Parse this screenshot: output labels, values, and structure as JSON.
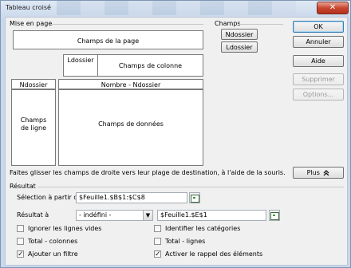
{
  "window": {
    "title": "Tableau croisé",
    "close_glyph": "✕"
  },
  "layout_group": {
    "label": "Mise en page",
    "page_fields": "Champs de la page",
    "column_field_tag": "Ldossier",
    "column_fields": "Champs de colonne",
    "row_field_tag": "Ndossier",
    "data_field_tag": "Nombre - Ndossier",
    "row_fields_line1": "Champs",
    "row_fields_line2": "de ligne",
    "data_fields": "Champs de données",
    "hint": "Faites glisser les champs de droite vers leur plage de destination, à l'aide de la souris."
  },
  "fields_group": {
    "label": "Champs",
    "items": [
      "Ndossier",
      "Ldossier"
    ]
  },
  "buttons": {
    "ok": "OK",
    "cancel": "Annuler",
    "help": "Aide",
    "delete": "Supprimer",
    "options": "Options...",
    "more": "Plus",
    "more_icon": "double-chevron-up-icon"
  },
  "result_group": {
    "label": "Résultat",
    "selection_label": "Sélection à partir de",
    "selection_value": "$Feuille1.$B$1:$C$8",
    "result_label": "Résultat à",
    "result_combo_value": "- indéfini -",
    "result_value": "$Feuille1.$E$1",
    "options": [
      {
        "label": "Ignorer les lignes vides",
        "checked": false
      },
      {
        "label": "Identifier les catégories",
        "checked": false
      },
      {
        "label": "Total - colonnes",
        "checked": false
      },
      {
        "label": "Total - lignes",
        "checked": false
      },
      {
        "label": "Ajouter un filtre",
        "checked": true
      },
      {
        "label": "Activer le rappel des éléments",
        "checked": true
      }
    ],
    "check_glyph": "✓"
  }
}
